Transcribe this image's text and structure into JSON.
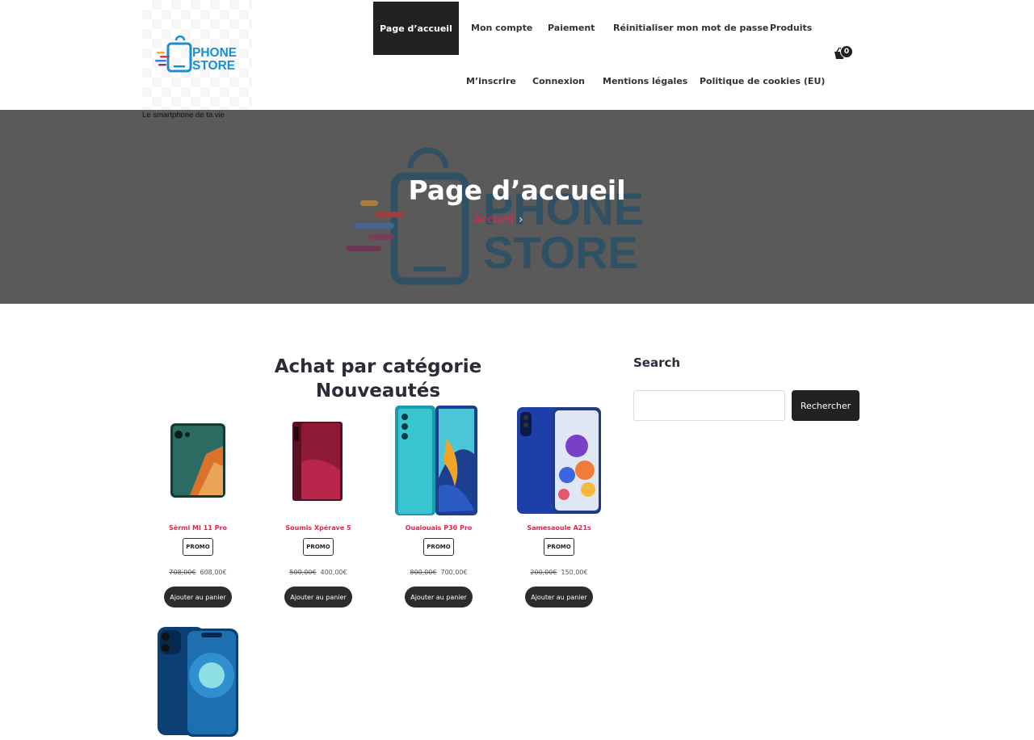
{
  "site": {
    "logo_line1": "PHONE",
    "logo_line2": "STORE",
    "tagline": "Le smartphone de ta vie"
  },
  "nav": {
    "row1": [
      "Page d’accueil",
      "Mon compte",
      "Paiement",
      "Réinitialiser mon mot de passe",
      "Produits"
    ],
    "row2": [
      "M’inscrire",
      "Connexion",
      "Mentions légales",
      "Politique de cookies (EU)"
    ],
    "active": "Page d’accueil",
    "cart_count": "0"
  },
  "hero": {
    "title": "Page d’accueil",
    "breadcrumb": "Accueil",
    "breadcrumb_sep": "›",
    "watermark_line1": "PHONE",
    "watermark_line2": "STORE"
  },
  "main": {
    "title_line1": "Achat par catégorie",
    "title_line2": "Nouveautés",
    "products": [
      {
        "name": "Sèrmi MI 11 Pro",
        "badge": "PROMO",
        "old_price": "708,00€",
        "price": "608,00€",
        "button": "Ajouter au panier"
      },
      {
        "name": "Soumis Xpérave 5",
        "badge": "PROMO",
        "old_price": "500,00€",
        "price": "400,00€",
        "button": "Ajouter au panier"
      },
      {
        "name": "Ouaiouais P30 Pro",
        "badge": "PROMO",
        "old_price": "800,00€",
        "price": "700,00€",
        "button": "Ajouter au panier"
      },
      {
        "name": "Samesaoule A21s",
        "badge": "PROMO",
        "old_price": "200,00€",
        "price": "150,00€",
        "button": "Ajouter au panier"
      }
    ]
  },
  "sidebar": {
    "search_title": "Search",
    "search_value": "",
    "search_button": "Rechercher"
  },
  "colors": {
    "accent": "#e8214f",
    "dark": "#222222",
    "hero_bg": "#5a5a5a",
    "logo_blue": "#1a8fd0"
  }
}
